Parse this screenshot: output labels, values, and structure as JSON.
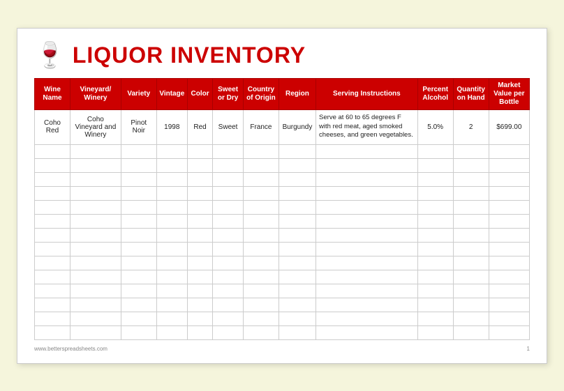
{
  "header": {
    "title": "LIQUOR INVENTORY",
    "icon": "🍷"
  },
  "table": {
    "columns": [
      {
        "key": "wine_name",
        "label": "Wine Name"
      },
      {
        "key": "vineyard",
        "label": "Vineyard/Winery"
      },
      {
        "key": "variety",
        "label": "Variety"
      },
      {
        "key": "vintage",
        "label": "Vintage"
      },
      {
        "key": "color",
        "label": "Color"
      },
      {
        "key": "sweet_dry",
        "label": "Sweet or Dry"
      },
      {
        "key": "country",
        "label": "Country of Origin"
      },
      {
        "key": "region",
        "label": "Region"
      },
      {
        "key": "serving",
        "label": "Serving Instructions"
      },
      {
        "key": "percent",
        "label": "Percent Alcohol"
      },
      {
        "key": "quantity",
        "label": "Quantity on Hand"
      },
      {
        "key": "market_value",
        "label": "Market Value per Bottle"
      }
    ],
    "data_row": {
      "wine_name": "Coho Red",
      "vineyard": "Coho Vineyard and Winery",
      "variety": "Pinot Noir",
      "vintage": "1998",
      "color": "Red",
      "sweet_dry": "Sweet",
      "country": "France",
      "region": "Burgundy",
      "serving": "Serve at 60 to 65 degrees F with red meat, aged smoked cheeses, and green vegetables.",
      "percent": "5.0%",
      "quantity": "2",
      "market_value": "$699.00"
    },
    "empty_rows": 14
  },
  "footer": {
    "left": "www.betterspreadsheets.com",
    "right": "1"
  }
}
